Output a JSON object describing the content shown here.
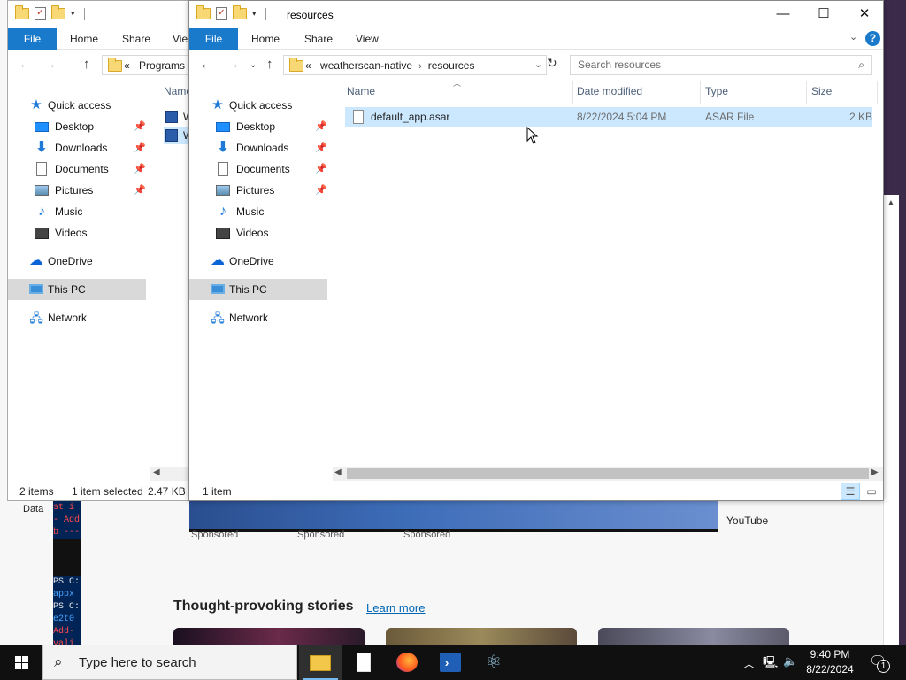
{
  "background": {
    "data_label": "Data",
    "terminal_lines": [
      {
        "text": "st i",
        "color": "red"
      },
      {
        "text": "- Add",
        "color": "red"
      },
      {
        "text": "b  ---",
        "color": "red"
      },
      {
        "text": "",
        "color": "black"
      },
      {
        "text": "",
        "color": "black"
      },
      {
        "text": "",
        "color": "black"
      },
      {
        "text": "PS C:",
        "color": "white"
      },
      {
        "text": "appx",
        "color": "blue"
      },
      {
        "text": "PS C:",
        "color": "white"
      },
      {
        "text": "e2t0",
        "color": "blue"
      },
      {
        "text": "Add-",
        "color": "red"
      },
      {
        "text": "vali",
        "color": "red"
      }
    ],
    "sponsored_labels": [
      "Sponsored",
      "Sponsored",
      "Sponsored"
    ],
    "youtube_label": "YouTube",
    "stories_title": "Thought-provoking stories",
    "learn_more": "Learn more"
  },
  "back_window": {
    "ribbon": {
      "file": "File",
      "home": "Home",
      "share": "Share",
      "view": "Vie"
    },
    "address": {
      "chevrons": "«",
      "path": "Programs"
    },
    "nav": {
      "quick_access": "Quick access",
      "desktop": "Desktop",
      "downloads": "Downloads",
      "documents": "Documents",
      "pictures": "Pictures",
      "music": "Music",
      "videos": "Videos",
      "onedrive": "OneDrive",
      "this_pc": "This PC",
      "network": "Network"
    },
    "column_name": "Name",
    "rows": [
      "W",
      "W"
    ],
    "status": {
      "items": "2 items",
      "selected": "1 item selected",
      "size": "2.47 KB"
    }
  },
  "front_window": {
    "title": "resources",
    "ribbon": {
      "file": "File",
      "home": "Home",
      "share": "Share",
      "view": "View"
    },
    "address": {
      "chevrons": "«",
      "segments": [
        "weatherscan-native",
        "resources"
      ]
    },
    "search_placeholder": "Search resources",
    "nav": {
      "quick_access": "Quick access",
      "desktop": "Desktop",
      "downloads": "Downloads",
      "documents": "Documents",
      "pictures": "Pictures",
      "music": "Music",
      "videos": "Videos",
      "onedrive": "OneDrive",
      "this_pc": "This PC",
      "network": "Network"
    },
    "columns": {
      "name": "Name",
      "date": "Date modified",
      "type": "Type",
      "size": "Size"
    },
    "files": [
      {
        "name": "default_app.asar",
        "date": "8/22/2024 5:04 PM",
        "type": "ASAR File",
        "size": "2 KB"
      }
    ],
    "status": {
      "items": "1 item"
    }
  },
  "taskbar": {
    "search_placeholder": "Type here to search",
    "apps": [
      "file-explorer",
      "notepad",
      "firefox",
      "powershell",
      "electron"
    ],
    "time": "9:40 PM",
    "date": "8/22/2024",
    "notification_count": "1"
  },
  "colors": {
    "accent": "#1979ca",
    "selection": "#cce8ff",
    "taskbar": "#101010"
  }
}
